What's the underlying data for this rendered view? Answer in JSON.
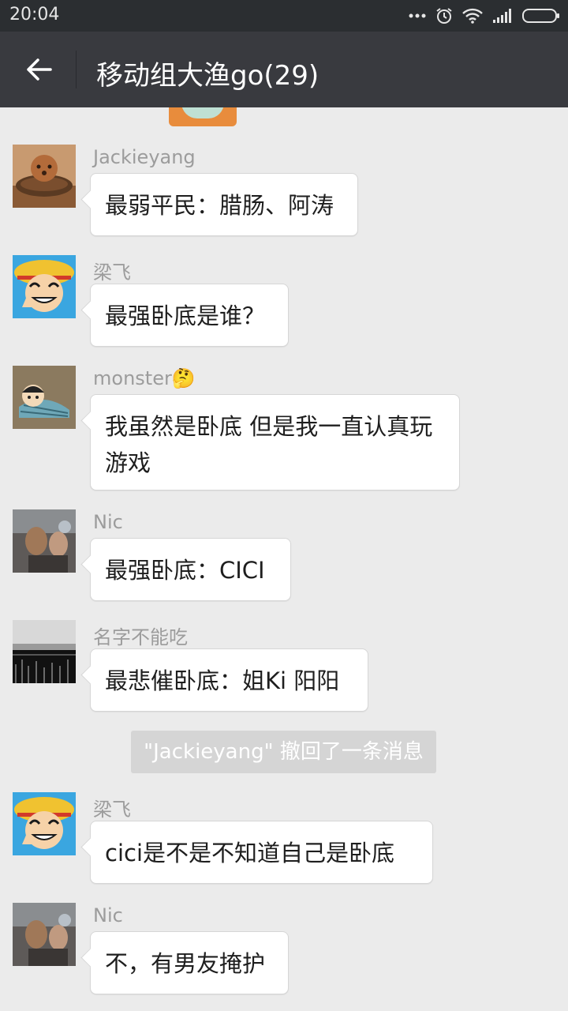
{
  "status_bar": {
    "time": "20:04",
    "icons": [
      "more-dots-icon",
      "alarm-icon",
      "wifi-icon",
      "signal-icon",
      "battery-icon"
    ]
  },
  "header": {
    "title": "移动组大渔go(29)",
    "back_icon": "back-arrow-icon"
  },
  "messages": [
    {
      "sender": "Jackieyang",
      "text": "最弱平民：腊肠、阿涛",
      "avatar": "dog-on-cushion"
    },
    {
      "sender": "梁飞",
      "text": "最强卧底是谁？",
      "avatar": "luffy-cartoon"
    },
    {
      "sender": "monster",
      "sender_emoji": "🤔",
      "text": "我虽然是卧底 但是我一直认真玩游戏",
      "avatar": "cartoon-boy-blanket"
    },
    {
      "sender": "Nic",
      "text": "最强卧底：CICI",
      "avatar": "photo-people"
    },
    {
      "sender": "名字不能吃",
      "text": "最悲催卧底：姐Ki 阳阳",
      "avatar": "landscape-bw"
    },
    {
      "sender": "梁飞",
      "text": "cici是不是不知道自己是卧底",
      "avatar": "luffy-cartoon"
    },
    {
      "sender": "Nic",
      "text": "不，有男友掩护",
      "avatar": "photo-people"
    }
  ],
  "system_message": "\"Jackieyang\" 撤回了一条消息",
  "colors": {
    "status_bar": "#2b2e31",
    "title_bar": "#393a3f",
    "chat_bg": "#ebebeb",
    "bubble": "#ffffff",
    "sender_name": "#9c9c9c"
  }
}
